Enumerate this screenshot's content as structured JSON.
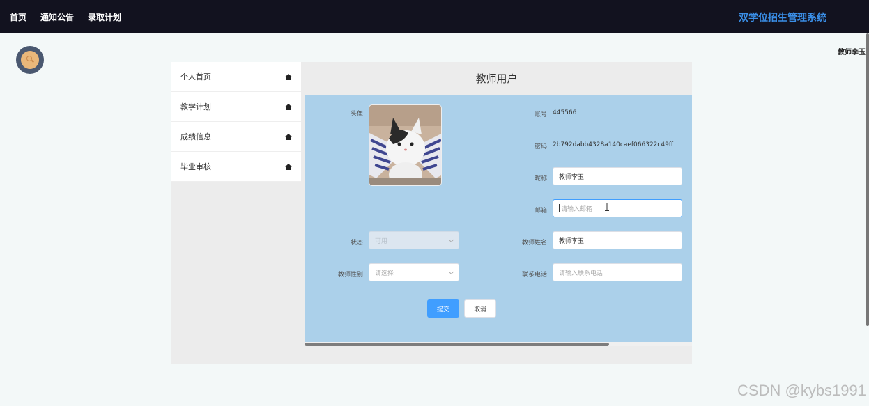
{
  "topnav": [
    "首页",
    "通知公告",
    "录取计划"
  ],
  "brand": "双学位招生管理系统",
  "username": "教师李玉",
  "sidebar": [
    {
      "label": "个人首页",
      "icon": "home-icon"
    },
    {
      "label": "教学计划",
      "icon": "home-icon"
    },
    {
      "label": "成绩信息",
      "icon": "home-icon"
    },
    {
      "label": "毕业审核",
      "icon": "home-icon"
    }
  ],
  "page_title": "教师用户",
  "form": {
    "avatar_label": "头像",
    "account_label": "账号",
    "account_value": "445566",
    "password_label": "密码",
    "password_value": "2b792dabb4328a140caef066322c49ff",
    "nickname_label": "昵称",
    "nickname_value": "教师李玉",
    "email_label": "邮箱",
    "email_placeholder": "请输入邮箱",
    "status_label": "状态",
    "status_value": "可用",
    "teacher_name_label": "教师姓名",
    "teacher_name_value": "教师李玉",
    "gender_label": "教师性别",
    "gender_placeholder": "请选择",
    "phone_label": "联系电话",
    "phone_placeholder": "请输入联系电话",
    "submit_label": "提交",
    "cancel_label": "取消"
  },
  "watermark": "CSDN @kybs1991",
  "colors": {
    "topbar": "#12121f",
    "brand": "#3a8ee6",
    "form_bg": "#abd0ea",
    "primary": "#409eff"
  }
}
